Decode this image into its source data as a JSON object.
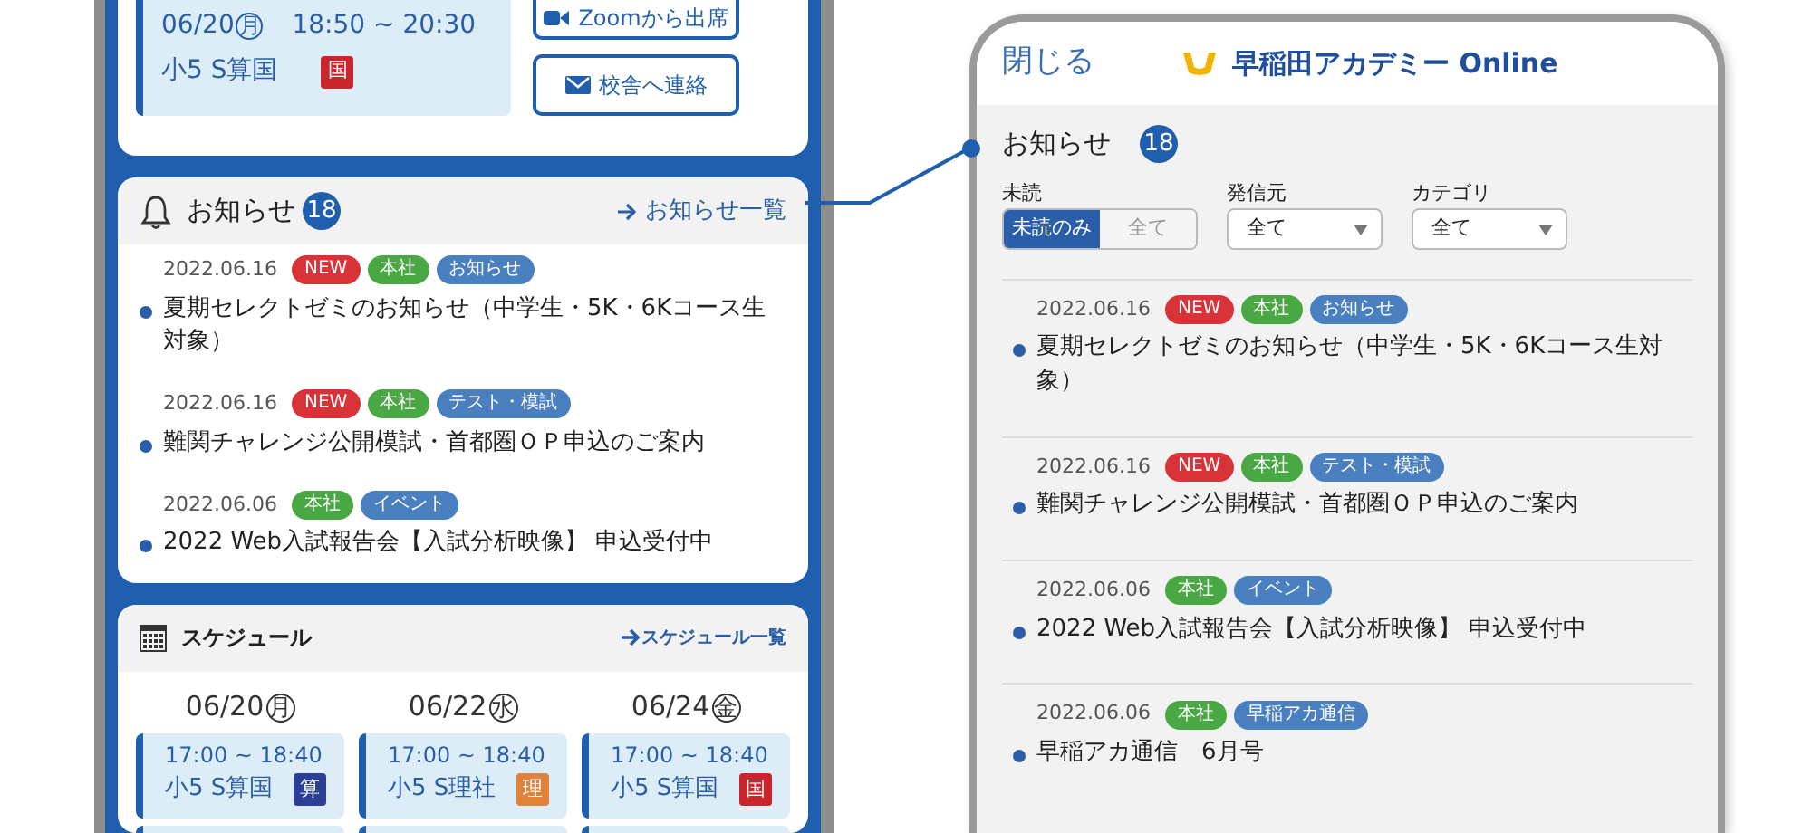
{
  "left_phone": {
    "top_card": {
      "lesson": {
        "date": "06/20",
        "weekday": "月",
        "time": "18:50 ~ 20:30",
        "course": "小5 S算国",
        "subject": "国",
        "color": "#c8262c"
      },
      "buttons": [
        {
          "label": "Zoomから出席",
          "kind": "zoom"
        },
        {
          "label": "校舎へ連絡",
          "kind": "mail"
        }
      ]
    },
    "notices": {
      "title": "お知らせ",
      "count": "18",
      "link": "お知らせ一覧",
      "items": [
        {
          "date": "2022.06.16",
          "tags": [
            {
              "label": "NEW",
              "kind": "new"
            },
            {
              "label": "本社",
              "kind": "source"
            },
            {
              "label": "お知らせ",
              "kind": "category"
            }
          ],
          "title": "夏期セレクトゼミのお知らせ（中学生・5K・6Kコース生対象）"
        },
        {
          "date": "2022.06.16",
          "tags": [
            {
              "label": "NEW",
              "kind": "new"
            },
            {
              "label": "本社",
              "kind": "source"
            },
            {
              "label": "テスト・模試",
              "kind": "category"
            }
          ],
          "title": "難関チャレンジ公開模試・首都圏ＯＰ申込のご案内"
        },
        {
          "date": "2022.06.06",
          "tags": [
            {
              "label": "本社",
              "kind": "source"
            },
            {
              "label": "イベント",
              "kind": "category"
            }
          ],
          "title": "2022 Web入試報告会【入試分析映像】 申込受付中"
        }
      ]
    },
    "schedule": {
      "title": "スケジュール",
      "link": "スケジュール一覧",
      "days": [
        {
          "date": "06/20",
          "weekday": "月",
          "lessons": [
            {
              "time": "17:00 ~ 18:40",
              "course": "小5 S算国",
              "subject": "算",
              "color": "#2b3f94"
            }
          ]
        },
        {
          "date": "06/22",
          "weekday": "水",
          "lessons": [
            {
              "time": "17:00 ~ 18:40",
              "course": "小5 S理社",
              "subject": "理",
              "color": "#e0823a"
            }
          ]
        },
        {
          "date": "06/24",
          "weekday": "金",
          "lessons": [
            {
              "time": "17:00 ~ 18:40",
              "course": "小5 S算国",
              "subject": "国",
              "color": "#c8262c"
            }
          ]
        }
      ]
    }
  },
  "right_phone": {
    "close": "閉じる",
    "logo": "早稲田アカデミー Online",
    "title": "お知らせ",
    "count": "18",
    "unread_filter": {
      "label": "未読",
      "options": [
        {
          "label": "未読のみ",
          "selected": true
        },
        {
          "label": "全て",
          "selected": false
        }
      ]
    },
    "selects": [
      {
        "label": "発信元",
        "value": "全て"
      },
      {
        "label": "カテゴリ",
        "value": "全て"
      }
    ],
    "items": [
      {
        "date": "2022.06.16",
        "tags": [
          {
            "label": "NEW",
            "kind": "new"
          },
          {
            "label": "本社",
            "kind": "source"
          },
          {
            "label": "お知らせ",
            "kind": "category"
          }
        ],
        "title": "夏期セレクトゼミのお知らせ（中学生・5K・6Kコース生対象）"
      },
      {
        "date": "2022.06.16",
        "tags": [
          {
            "label": "NEW",
            "kind": "new"
          },
          {
            "label": "本社",
            "kind": "source"
          },
          {
            "label": "テスト・模試",
            "kind": "category"
          }
        ],
        "title": "難関チャレンジ公開模試・首都圏ＯＰ申込のご案内"
      },
      {
        "date": "2022.06.06",
        "tags": [
          {
            "label": "本社",
            "kind": "source"
          },
          {
            "label": "イベント",
            "kind": "category"
          }
        ],
        "title": "2022 Web入試報告会【入試分析映像】 申込受付中"
      },
      {
        "date": "2022.06.06",
        "tags": [
          {
            "label": "本社",
            "kind": "source"
          },
          {
            "label": "早稲アカ通信",
            "kind": "category"
          }
        ],
        "title": "早稲アカ通信　6月号"
      }
    ]
  }
}
